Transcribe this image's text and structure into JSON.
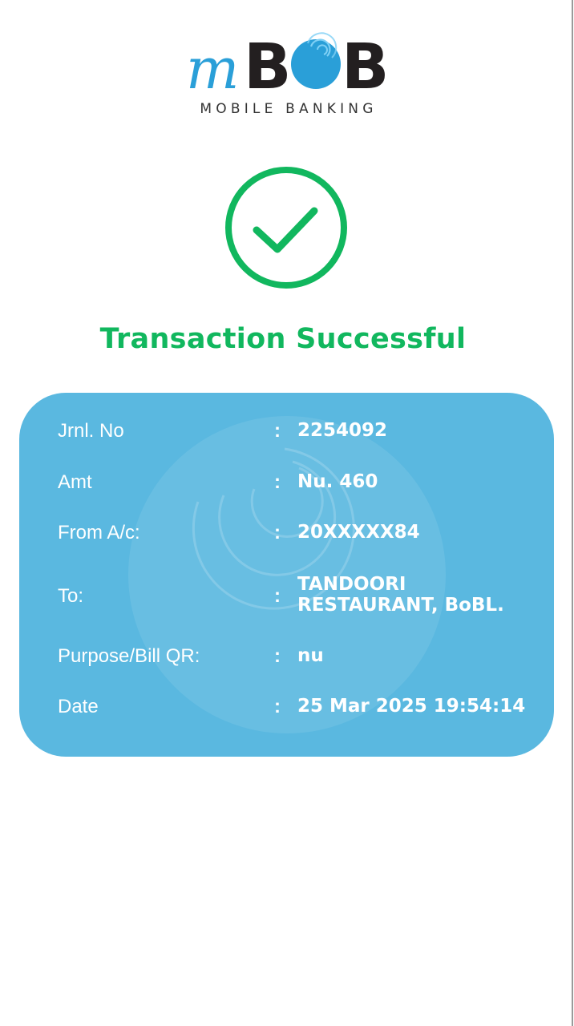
{
  "brand": {
    "logo_prefix": "m",
    "logo_name": "BOB",
    "tagline": "MOBILE BANKING",
    "colors": {
      "logo_blue": "#2a9fd8",
      "logo_dark": "#231f20"
    }
  },
  "status": {
    "icon": "check-circle-icon",
    "title": "Transaction Successful",
    "color": "#11b75e"
  },
  "details": {
    "card_color": "#5ab8e0",
    "separator": ":",
    "rows": [
      {
        "label": "Jrnl. No",
        "value": "2254092"
      },
      {
        "label": "Amt",
        "value": "Nu. 460"
      },
      {
        "label": "From A/c:",
        "value": "20XXXXX84"
      },
      {
        "label": "To:",
        "value": "TANDOORI RESTAURANT, BoBL."
      },
      {
        "label": "Purpose/Bill QR:",
        "value": "nu"
      },
      {
        "label": "Date",
        "value": "25 Mar 2025 19:54:14"
      }
    ]
  }
}
